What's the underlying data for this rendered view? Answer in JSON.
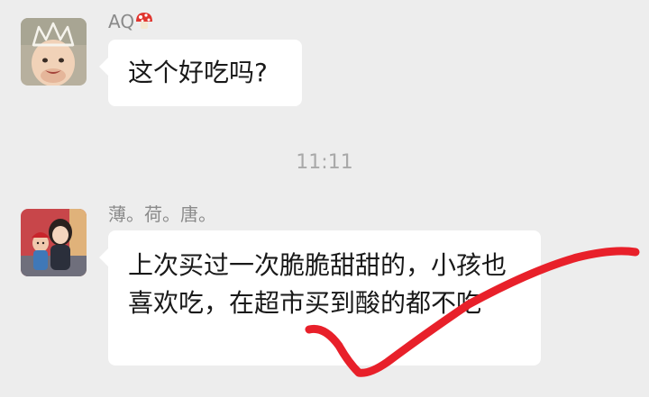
{
  "chat": {
    "messages": [
      {
        "sender": "AQ",
        "sender_emoji": "mushroom-emoji",
        "avatar": "baby-with-crown-avatar",
        "text": "这个好吃吗?"
      },
      {
        "sender": "薄。荷。唐。",
        "avatar": "mother-and-child-avatar",
        "text": "上次买过一次脆脆甜甜的，小孩也喜欢吃，在超市买到酸的都不吃"
      }
    ],
    "timestamp": "11:11"
  },
  "colors": {
    "background": "#ededed",
    "bubble": "#ffffff",
    "text": "#191919",
    "sender": "#8a8a8a",
    "timestamp": "#a9a9a9",
    "checkmark": "#e8202a"
  },
  "annotation": {
    "shape": "checkmark",
    "color": "#e8202a"
  }
}
